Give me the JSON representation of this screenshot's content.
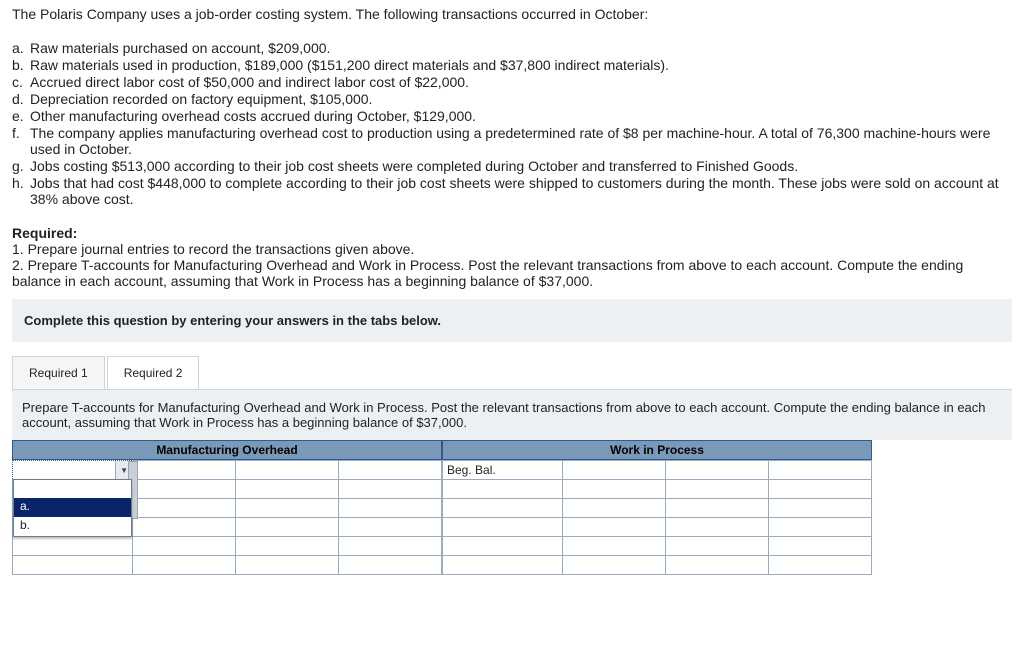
{
  "intro": "The Polaris Company uses a job-order costing system. The following transactions occurred in October:",
  "transactions": [
    {
      "prefix": "a.",
      "text": "Raw materials purchased on account, $209,000."
    },
    {
      "prefix": "b.",
      "text": "Raw materials used in production, $189,000 ($151,200 direct materials and $37,800 indirect materials)."
    },
    {
      "prefix": "c.",
      "text": "Accrued direct labor cost of $50,000 and indirect labor cost of $22,000."
    },
    {
      "prefix": "d.",
      "text": "Depreciation recorded on factory equipment, $105,000."
    },
    {
      "prefix": "e.",
      "text": "Other manufacturing overhead costs accrued during October, $129,000."
    },
    {
      "prefix": "f.",
      "text": "The company applies manufacturing overhead cost to production using a predetermined rate of $8 per machine-hour. A total of 76,300 machine-hours were used in October."
    },
    {
      "prefix": "g.",
      "text": "Jobs costing $513,000 according to their job cost sheets were completed during October and transferred to Finished Goods."
    },
    {
      "prefix": "h.",
      "text": "Jobs that had cost $448,000 to complete according to their job cost sheets were shipped to customers during the month. These jobs were sold on account at 38% above cost."
    }
  ],
  "required": {
    "title": "Required:",
    "line1": "1. Prepare journal entries to record the transactions given above.",
    "line2": "2. Prepare T-accounts for Manufacturing Overhead and Work in Process. Post the relevant transactions from above to each account. Compute the ending balance in each account, assuming that Work in Process has a beginning balance of $37,000."
  },
  "instruction_bar": "Complete this question by entering your answers in the tabs below.",
  "tabs": {
    "t1": "Required 1",
    "t2": "Required 2"
  },
  "tab_desc": "Prepare T-accounts for Manufacturing Overhead and Work in Process. Post the relevant transactions from above to each account. Compute the ending balance in each account, assuming that Work in Process has a beginning balance of $37,000.",
  "tacct": {
    "left_header": "Manufacturing Overhead",
    "right_header": "Work in Process",
    "begbal": "Beg. Bal."
  },
  "dropdown": {
    "opt_a": "a.",
    "opt_b": "b."
  }
}
